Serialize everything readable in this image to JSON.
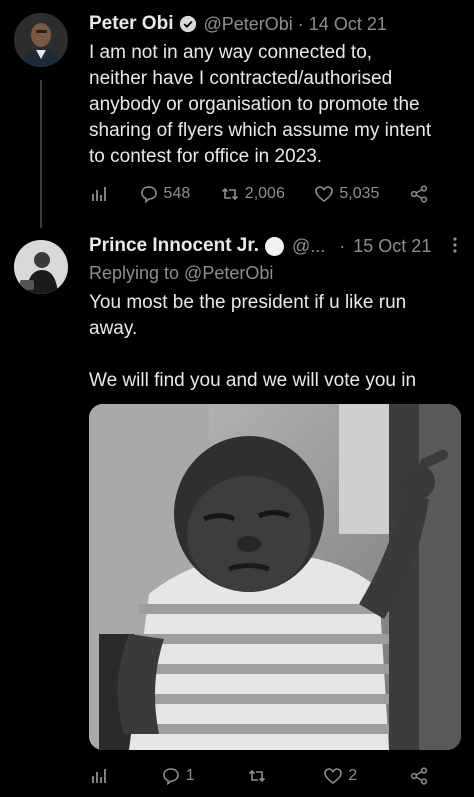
{
  "tweet1": {
    "name": "Peter Obi",
    "handle": "@PeterObi",
    "separator": "·",
    "date": "14 Oct 21",
    "lines": [
      "I am not in any way connected to,",
      "neither have I contracted/authorised",
      "anybody or organisation to promote the",
      "sharing of flyers which assume my intent",
      "to contest for office in 2023."
    ],
    "replies": "548",
    "retweets": "2,006",
    "likes": "5,035"
  },
  "tweet2": {
    "name": "Prince Innocent Jr.",
    "handle": "@...",
    "separator": "·",
    "date": "15 Oct 21",
    "replying_to": "Replying to @PeterObi",
    "lines": [
      "You most be the president if u like run",
      "away.",
      "",
      "We will find you and we will vote you in"
    ],
    "replies": "1",
    "retweets": "",
    "likes": "2"
  },
  "icons": {
    "verified": "verified-badge-icon",
    "analytics": "analytics-icon",
    "reply": "reply-icon",
    "retweet": "retweet-icon",
    "like": "heart-icon",
    "share": "share-icon",
    "more": "more-options-icon"
  },
  "colors": {
    "background": "#000000",
    "text": "#e7e9ea",
    "muted": "#8b8f94"
  }
}
